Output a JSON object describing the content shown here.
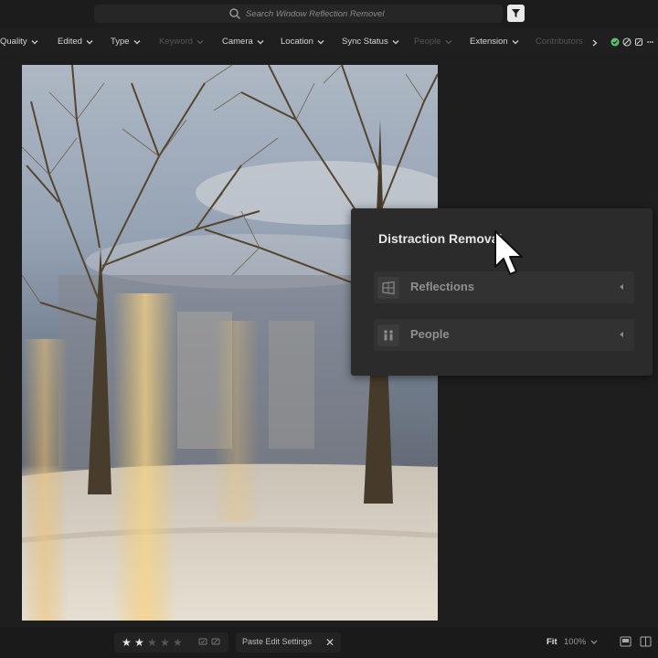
{
  "search": {
    "placeholder": "Search Window Reflection Removel"
  },
  "filters": [
    {
      "label": "Quality",
      "enabled": true
    },
    {
      "label": "Edited",
      "enabled": true
    },
    {
      "label": "Type",
      "enabled": true
    },
    {
      "label": "Keyword",
      "enabled": false
    },
    {
      "label": "Camera",
      "enabled": true
    },
    {
      "label": "Location",
      "enabled": true
    },
    {
      "label": "Sync Status",
      "enabled": true
    },
    {
      "label": "People",
      "enabled": false
    },
    {
      "label": "Extension",
      "enabled": true
    },
    {
      "label": "Contributors",
      "enabled": false
    }
  ],
  "panel": {
    "title": "Distraction Removal",
    "items": [
      {
        "label": "Reflections",
        "icon": "window-reflection-icon"
      },
      {
        "label": "People",
        "icon": "people-icon"
      }
    ]
  },
  "bottom": {
    "rating": 2,
    "max_rating": 5,
    "paste_label": "Paste Edit Settings",
    "fit_label": "Fit",
    "zoom_label": "100%"
  },
  "colors": {
    "accent_dot": "#e38a3a",
    "flag_green": "#5fbf6a"
  }
}
